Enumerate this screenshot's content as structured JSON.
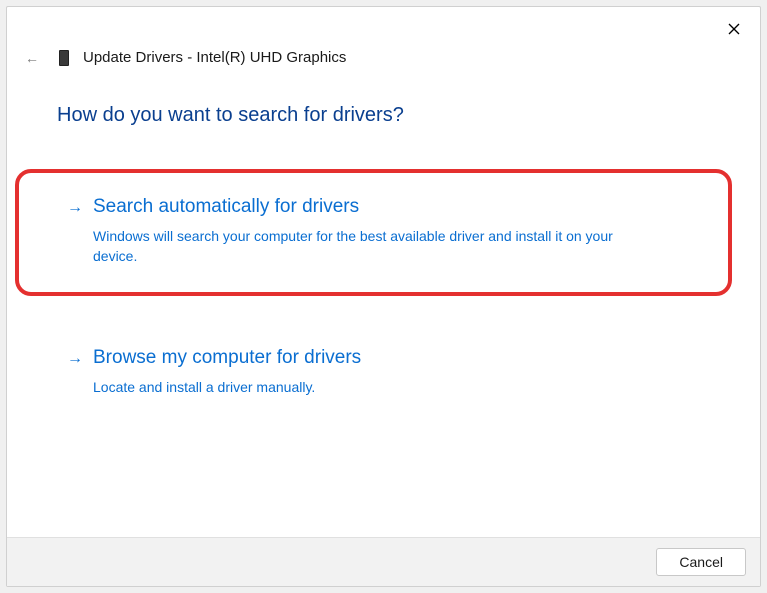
{
  "dialog": {
    "title": "Update Drivers - Intel(R) UHD Graphics",
    "heading": "How do you want to search for drivers?"
  },
  "options": [
    {
      "title": "Search automatically for drivers",
      "desc": "Windows will search your computer for the best available driver and install it on your device.",
      "highlighted": true
    },
    {
      "title": "Browse my computer for drivers",
      "desc": "Locate and install a driver manually.",
      "highlighted": false
    }
  ],
  "footer": {
    "cancel_label": "Cancel"
  },
  "highlight_color": "#e4302f",
  "link_color": "#0a6ed1"
}
